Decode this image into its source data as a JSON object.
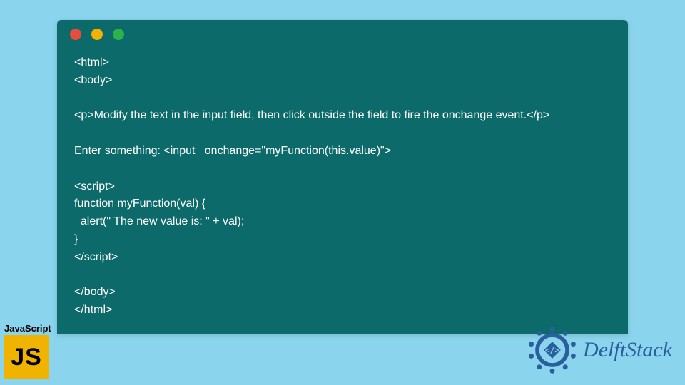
{
  "code": {
    "lines": [
      "<html>",
      "<body>",
      "",
      "<p>Modify the text in the input field, then click outside the field to fire the onchange event.</p>",
      "",
      "Enter something: <input   onchange=\"myFunction(this.value)\">",
      "",
      "<script>",
      "function myFunction(val) {",
      "  alert(\" The new value is: \" + val);",
      "}",
      "</script>",
      "",
      "</body>",
      "</html>"
    ]
  },
  "js_badge": {
    "label": "JavaScript",
    "tile_text": "JS"
  },
  "brand": {
    "name": "DelftStack"
  },
  "window_dots": [
    "red",
    "yellow",
    "green"
  ]
}
